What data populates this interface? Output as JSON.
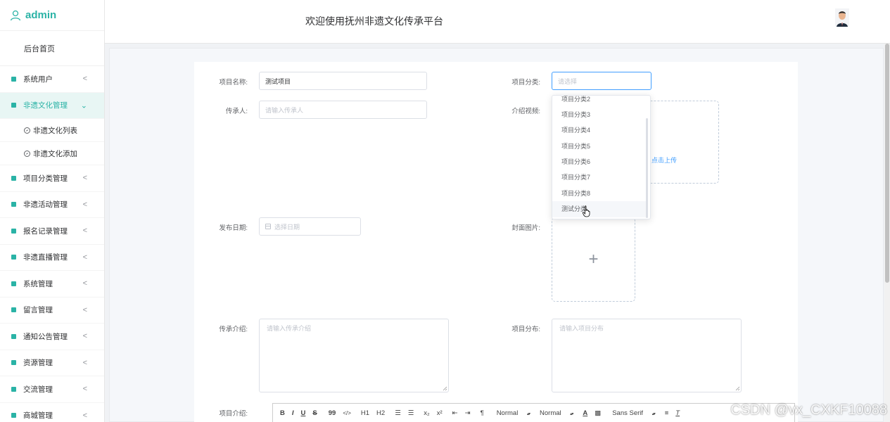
{
  "brand": {
    "name": "admin",
    "color": "#2ab3a6",
    "icon": "user-icon"
  },
  "sidebar": {
    "home": "后台首页",
    "items": [
      {
        "label": "系统用户",
        "arrow": "<",
        "active": false
      },
      {
        "label": "非遗文化管理",
        "arrow": "⌄",
        "active": true,
        "children": [
          {
            "label": "非遗文化列表"
          },
          {
            "label": "非遗文化添加"
          }
        ]
      },
      {
        "label": "项目分类管理",
        "arrow": "<"
      },
      {
        "label": "非遗活动管理",
        "arrow": "<"
      },
      {
        "label": "报名记录管理",
        "arrow": "<"
      },
      {
        "label": "非遗直播管理",
        "arrow": "<"
      },
      {
        "label": "系统管理",
        "arrow": "<"
      },
      {
        "label": "留言管理",
        "arrow": "<"
      },
      {
        "label": "通知公告管理",
        "arrow": "<"
      },
      {
        "label": "资源管理",
        "arrow": "<"
      },
      {
        "label": "交流管理",
        "arrow": "<"
      },
      {
        "label": "商城管理",
        "arrow": "<"
      }
    ]
  },
  "header": {
    "title": "欢迎使用抚州非遗文化传承平台",
    "avatar_icon": "avatar-icon"
  },
  "form": {
    "name_label": "项目名称:",
    "name_value": "测试项目",
    "category_label": "项目分类:",
    "category_placeholder": "请选择",
    "inheritor_label": "传承人:",
    "inheritor_placeholder": "请输入传承人",
    "video_label": "介绍视频:",
    "upload_text": "点击上传",
    "date_label": "发布日期:",
    "date_placeholder": "选择日期",
    "cover_label": "封面图片:",
    "cover_plus": "+",
    "intro_label": "传承介绍:",
    "intro_placeholder": "请输入传承介绍",
    "dist_label": "项目分布:",
    "dist_placeholder": "请输入项目分布",
    "proj_intro_label": "项目介绍:"
  },
  "dropdown": {
    "options": [
      "项目分类2",
      "项目分类3",
      "项目分类4",
      "项目分类5",
      "项目分类6",
      "项目分类7",
      "项目分类8",
      "测试分类"
    ],
    "hovered": "测试分类"
  },
  "toolbar": {
    "bold": "B",
    "italic": "I",
    "underline": "U",
    "strike": "S",
    "quote": "99",
    "code": "</>",
    "h1": "H1",
    "h2": "H2",
    "ol": "☰",
    "ul": "☰",
    "sub": "x₂",
    "sup": "x²",
    "outdent": "⇤",
    "indent": "⇥",
    "rtl": "¶",
    "size": "Normal",
    "header": "Normal",
    "color": "A",
    "bg": "▩",
    "font": "Sans Serif",
    "align": "≡",
    "clean": "T"
  },
  "watermark": "CSDN @vx_CXKF10088"
}
